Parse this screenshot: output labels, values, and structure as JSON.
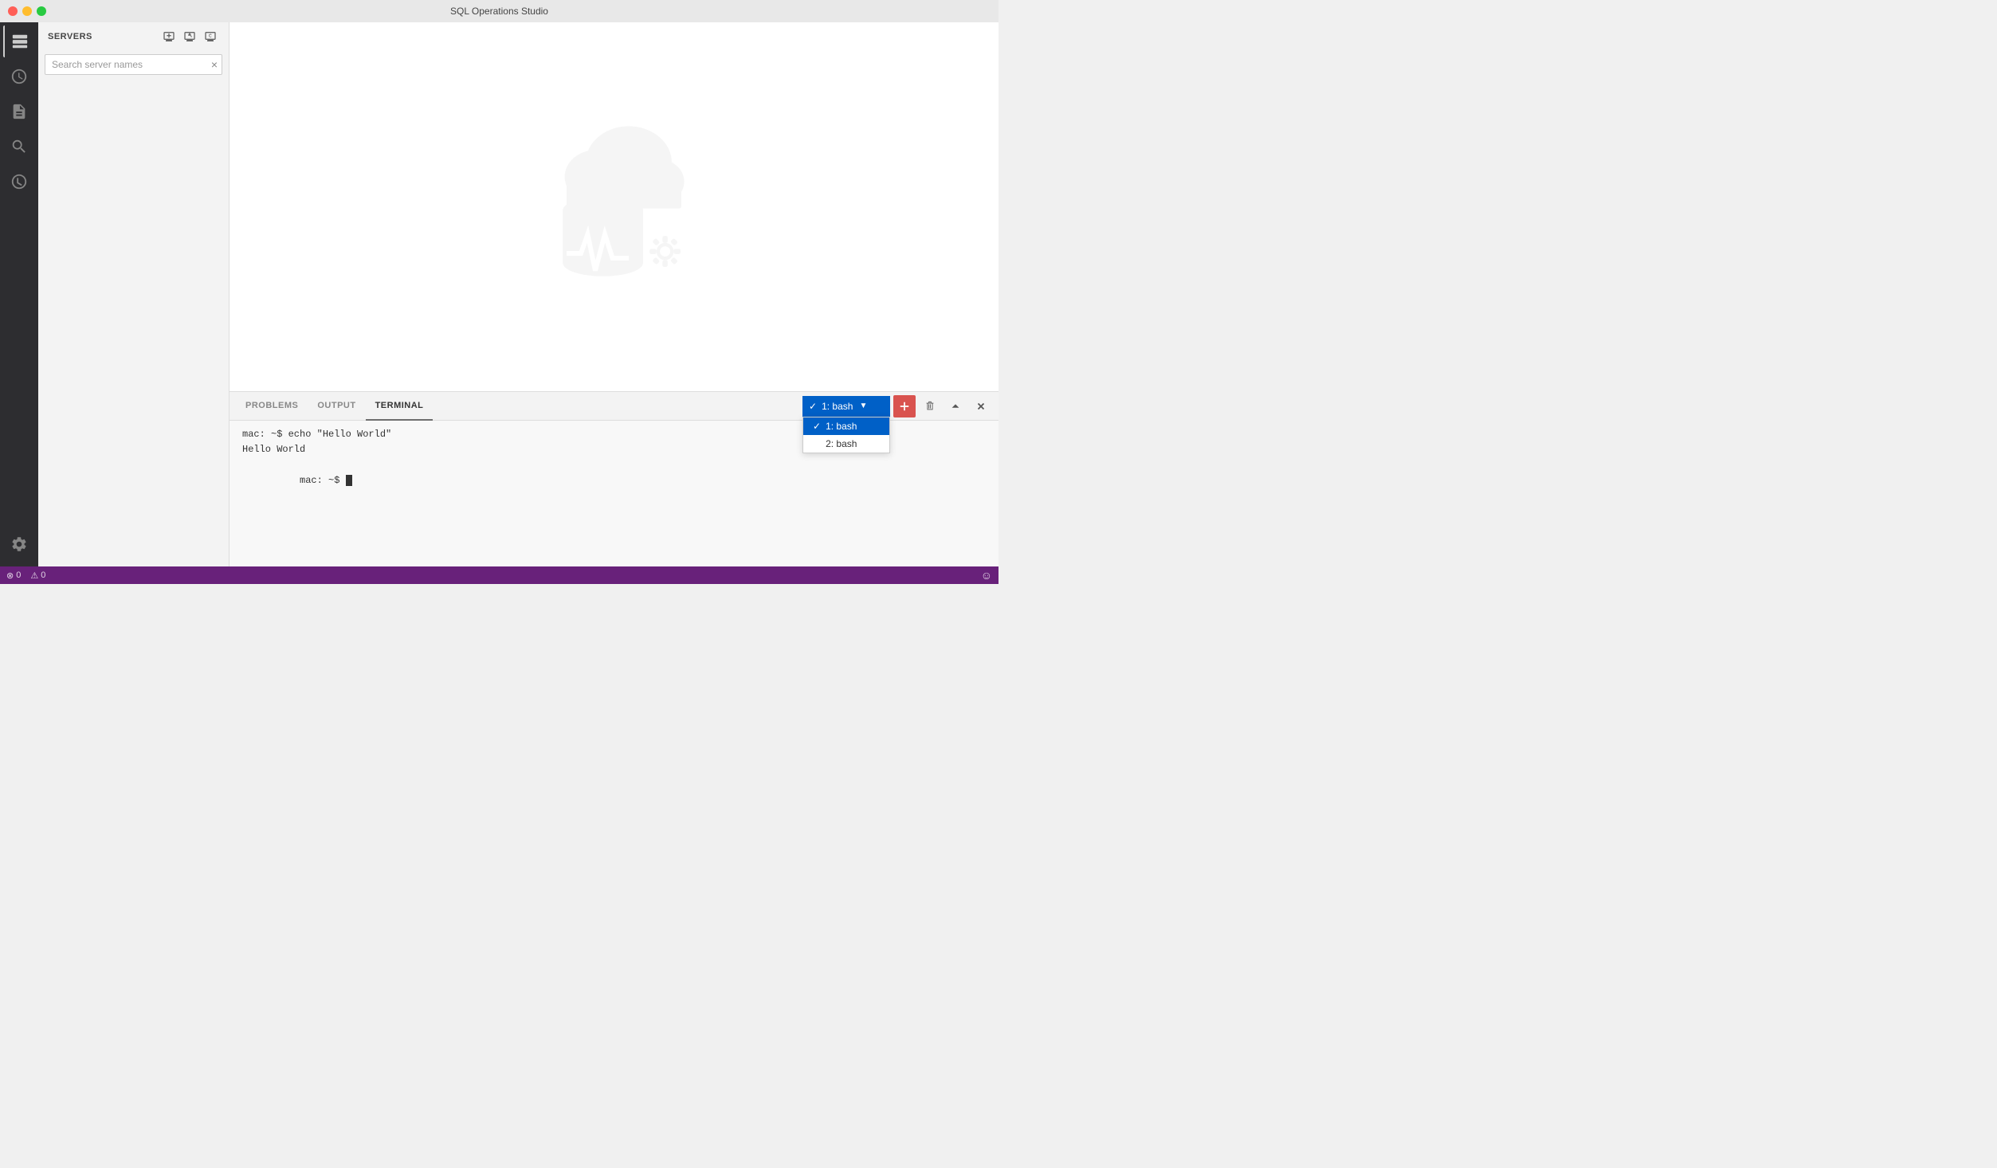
{
  "titlebar": {
    "title": "SQL Operations Studio"
  },
  "sidebar": {
    "title": "SERVERS",
    "search_placeholder": "Search server names",
    "action_buttons": [
      {
        "id": "new-server",
        "icon": "monitor-plus-icon",
        "label": "New Connection"
      },
      {
        "id": "new-query",
        "icon": "monitor-query-icon",
        "label": "New Query"
      },
      {
        "id": "refresh",
        "icon": "monitor-refresh-icon",
        "label": "Refresh"
      }
    ]
  },
  "panel": {
    "tabs": [
      {
        "id": "problems",
        "label": "PROBLEMS"
      },
      {
        "id": "output",
        "label": "OUTPUT"
      },
      {
        "id": "terminal",
        "label": "TERMINAL"
      }
    ],
    "active_tab": "TERMINAL",
    "terminal": {
      "sessions": [
        {
          "id": 1,
          "label": "1: bash"
        },
        {
          "id": 2,
          "label": "2: bash"
        }
      ],
      "selected_session": "1: bash",
      "lines": [
        "mac: ~$ echo \"Hello World\"",
        "Hello World",
        "mac: ~$ "
      ]
    },
    "actions": {
      "add_label": "+",
      "delete_label": "🗑",
      "collapse_label": "^",
      "close_label": "×"
    }
  },
  "status_bar": {
    "errors": "0",
    "warnings": "0",
    "smiley_icon": "☺"
  },
  "activity_bar": {
    "items": [
      {
        "id": "servers",
        "icon": "servers-icon",
        "active": true
      },
      {
        "id": "history",
        "icon": "history-icon",
        "active": false
      },
      {
        "id": "file",
        "icon": "file-icon",
        "active": false
      },
      {
        "id": "search",
        "icon": "search-icon",
        "active": false
      },
      {
        "id": "git",
        "icon": "git-icon",
        "active": false
      }
    ],
    "bottom_items": [
      {
        "id": "settings",
        "icon": "settings-icon"
      }
    ]
  }
}
